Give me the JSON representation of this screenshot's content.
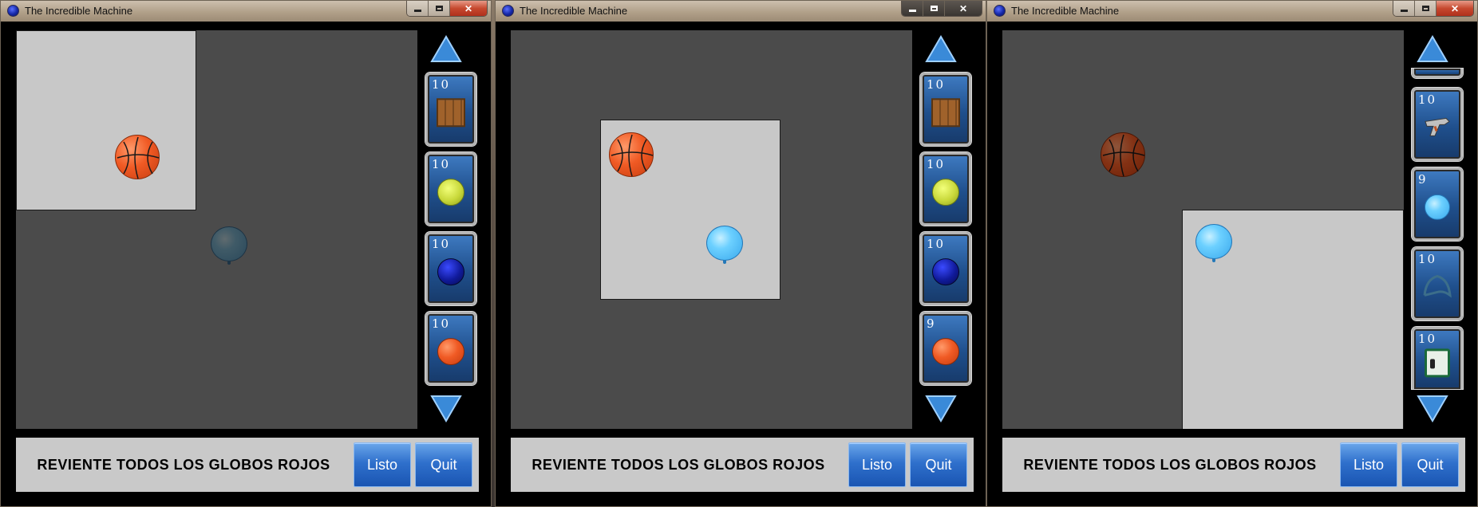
{
  "windows": [
    {
      "title": "The Incredible Machine",
      "goal": "REVIENTE TODOS LOS GLOBOS ROJOS",
      "listo_label": "Listo",
      "quit_label": "Quit",
      "palette": [
        {
          "count": "10",
          "item": "wood-crate"
        },
        {
          "count": "10",
          "item": "tennis-ball"
        },
        {
          "count": "10",
          "item": "bowling-ball"
        },
        {
          "count": "10",
          "item": "basketball"
        }
      ]
    },
    {
      "title": "The Incredible Machine",
      "goal": "REVIENTE TODOS LOS GLOBOS ROJOS",
      "listo_label": "Listo",
      "quit_label": "Quit",
      "palette": [
        {
          "count": "10",
          "item": "wood-crate"
        },
        {
          "count": "10",
          "item": "tennis-ball"
        },
        {
          "count": "10",
          "item": "bowling-ball"
        },
        {
          "count": "9",
          "item": "basketball"
        }
      ]
    },
    {
      "title": "The Incredible Machine",
      "goal": "REVIENTE TODOS LOS GLOBOS ROJOS",
      "listo_label": "Listo",
      "quit_label": "Quit",
      "palette": [
        {
          "count": "10",
          "item": "revolver"
        },
        {
          "count": "9",
          "item": "balloon"
        },
        {
          "count": "10",
          "item": "rope"
        },
        {
          "count": "10",
          "item": "conveyor"
        }
      ]
    }
  ],
  "colors": {
    "board_bg": "#4b4b4b",
    "panel_bg": "#c8c8c8",
    "button_blue": "#2f70cc",
    "slot_blue": "#1f4f8c"
  }
}
